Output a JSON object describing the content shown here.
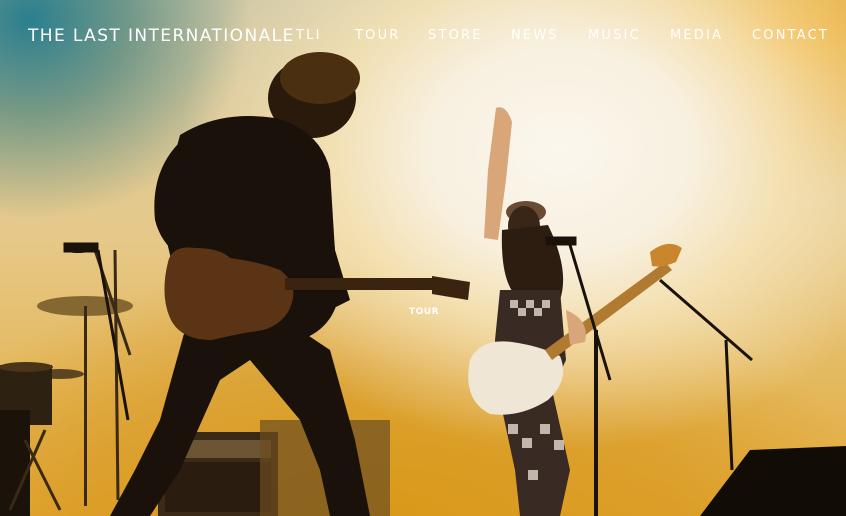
{
  "site": {
    "logo": "THE LAST INTERNATIONALE"
  },
  "nav": {
    "items": [
      {
        "label": "TLI"
      },
      {
        "label": "TOUR"
      },
      {
        "label": "STORE"
      },
      {
        "label": "NEWS"
      },
      {
        "label": "MUSIC"
      },
      {
        "label": "MEDIA"
      },
      {
        "label": "CONTACT"
      }
    ]
  },
  "hero": {
    "overlay_label": "TOUR"
  },
  "colors": {
    "nav_text": "#ffffff",
    "stage_glow": "#e3aa36",
    "silhouette": "#1a120a"
  }
}
